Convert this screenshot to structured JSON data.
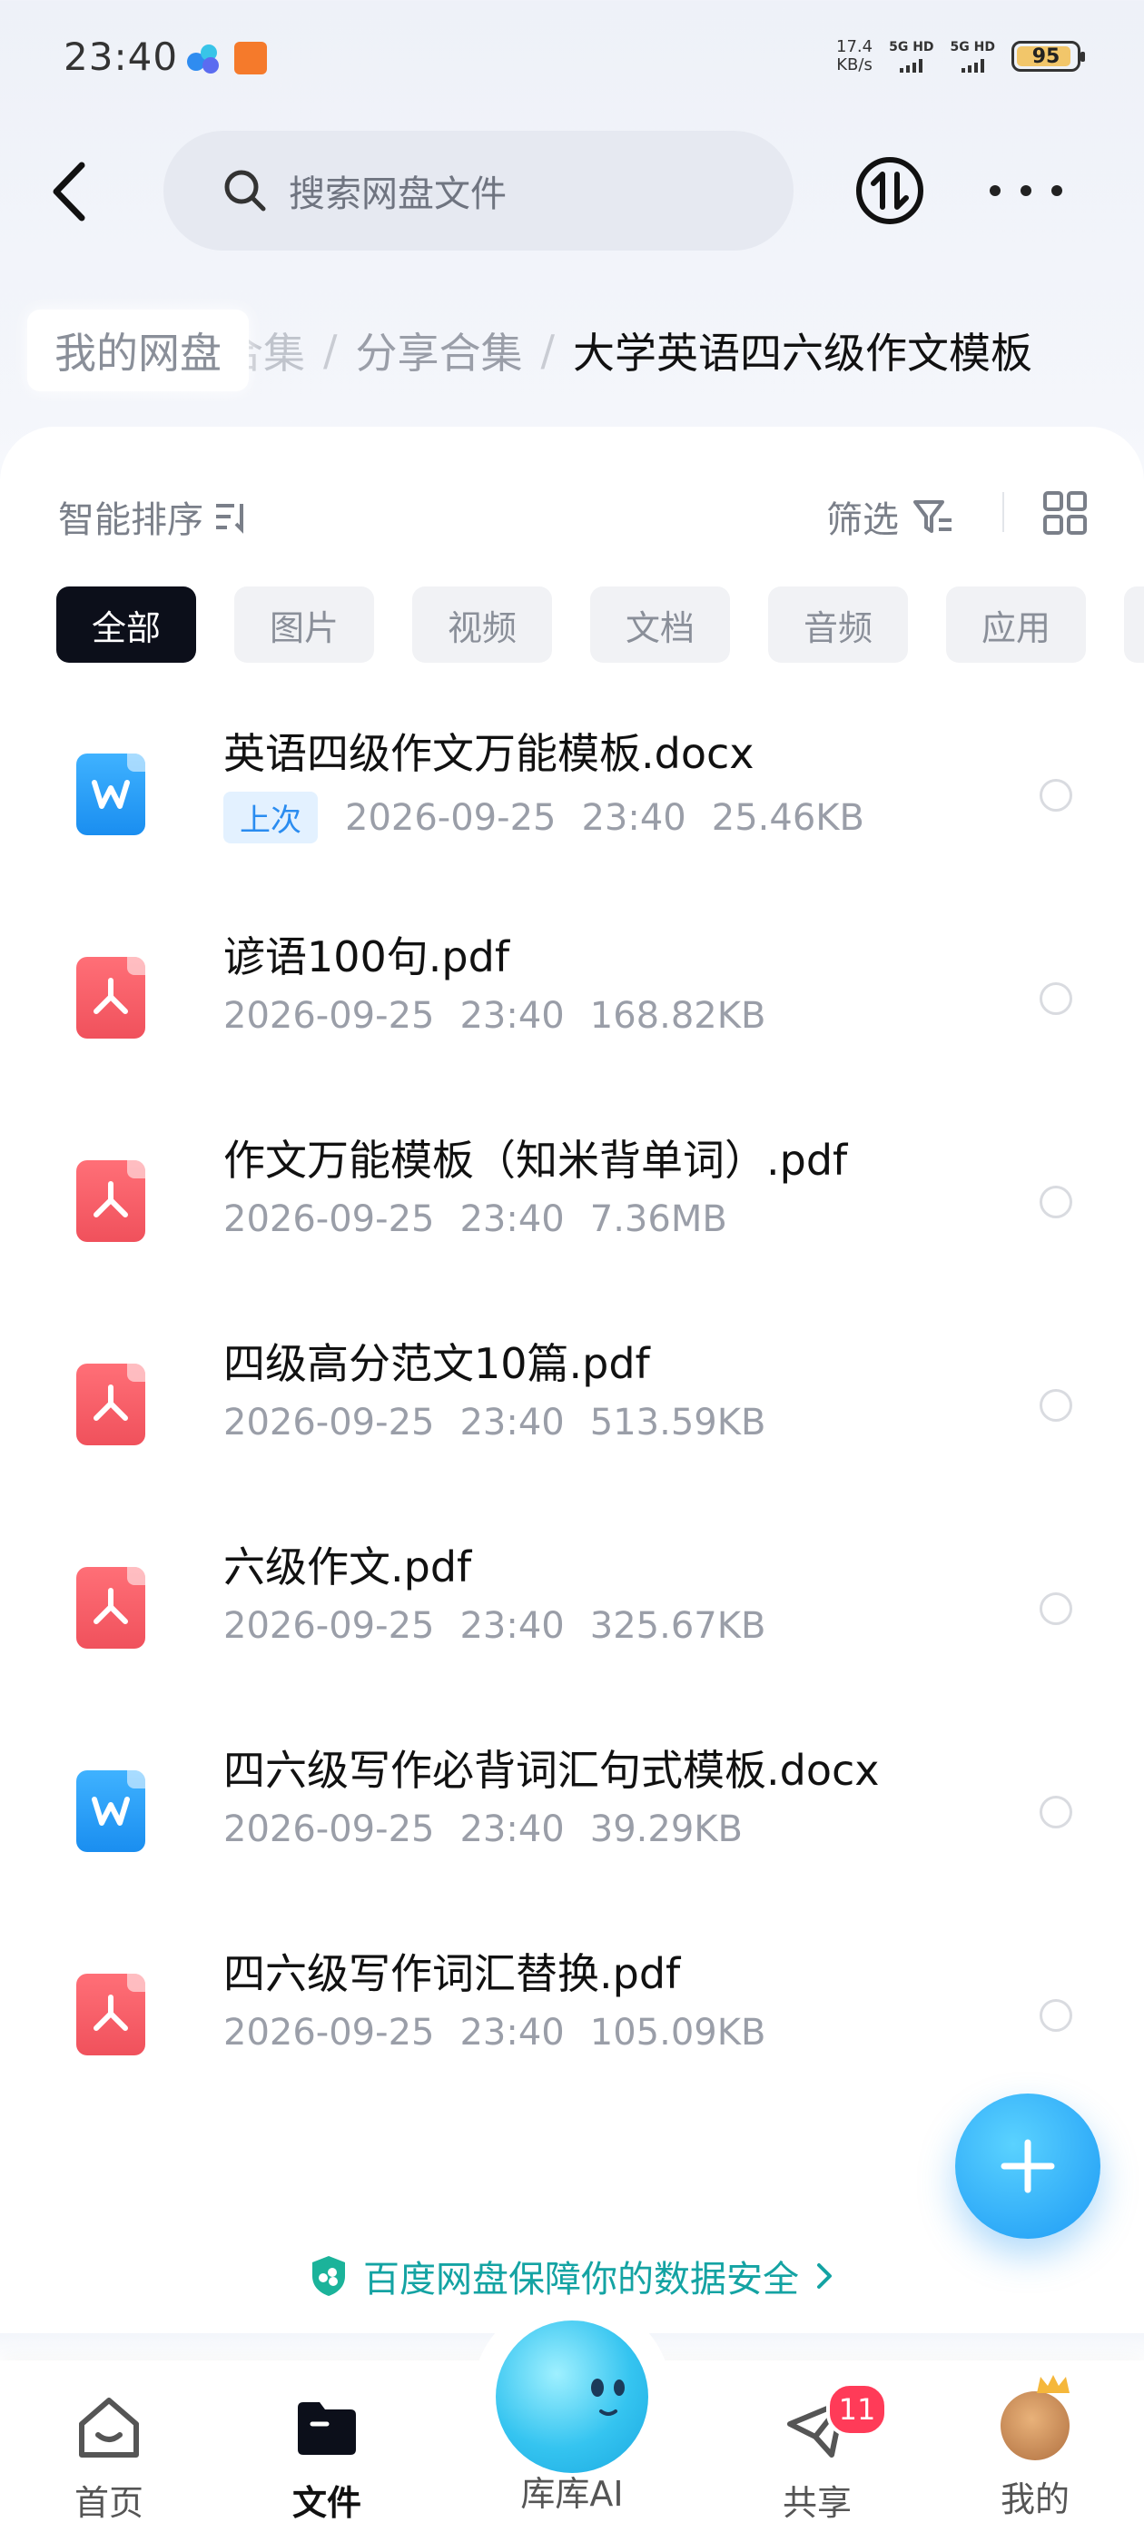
{
  "status_bar": {
    "time": "23:40",
    "speed_value": "17.4",
    "speed_unit": "KB/s",
    "sim1": "5G HD",
    "sim2": "5G HD",
    "battery": "95"
  },
  "top_bar": {
    "search_placeholder": "搜索网盘文件",
    "icons": [
      "back-icon",
      "search-icon",
      "transfer-icon",
      "more-icon"
    ]
  },
  "breadcrumb": {
    "root": "我的网盘",
    "hidden_fragment": "合集",
    "middle": "分享合集",
    "separator": "/",
    "current": "大学英语四六级作文模板"
  },
  "toolbar": {
    "sort_label": "智能排序",
    "filter_label": "筛选"
  },
  "chips": [
    "全部",
    "图片",
    "视频",
    "文档",
    "音频",
    "应用"
  ],
  "files": [
    {
      "name": "英语四级作文万能模板.docx",
      "type": "word",
      "tag": "上次",
      "date": "2026-09-25",
      "time": "23:40",
      "size": "25.46KB"
    },
    {
      "name": "谚语100句.pdf",
      "type": "pdf",
      "date": "2026-09-25",
      "time": "23:40",
      "size": "168.82KB"
    },
    {
      "name": "作文万能模板（知米背单词）.pdf",
      "type": "pdf",
      "date": "2026-09-25",
      "time": "23:40",
      "size": "7.36MB"
    },
    {
      "name": "四级高分范文10篇.pdf",
      "type": "pdf",
      "date": "2026-09-25",
      "time": "23:40",
      "size": "513.59KB"
    },
    {
      "name": "六级作文.pdf",
      "type": "pdf",
      "date": "2026-09-25",
      "time": "23:40",
      "size": "325.67KB"
    },
    {
      "name": "四六级写作必背词汇句式模板.docx",
      "type": "word",
      "date": "2026-09-25",
      "time": "23:40",
      "size": "39.29KB"
    },
    {
      "name": "四六级写作词汇替换.pdf",
      "type": "pdf",
      "date": "2026-09-25",
      "time": "23:40",
      "size": "105.09KB"
    }
  ],
  "security_text": "百度网盘保障你的数据安全",
  "bottom_nav": {
    "home": "首页",
    "files": "文件",
    "ai": "库库AI",
    "share": "共享",
    "share_badge": "11",
    "me": "我的"
  },
  "colors": {
    "accent": "#1d9af5",
    "word": "#2a9cf5",
    "pdf": "#f25c66",
    "secure": "#14a3a3",
    "badge": "#ff3b58"
  }
}
